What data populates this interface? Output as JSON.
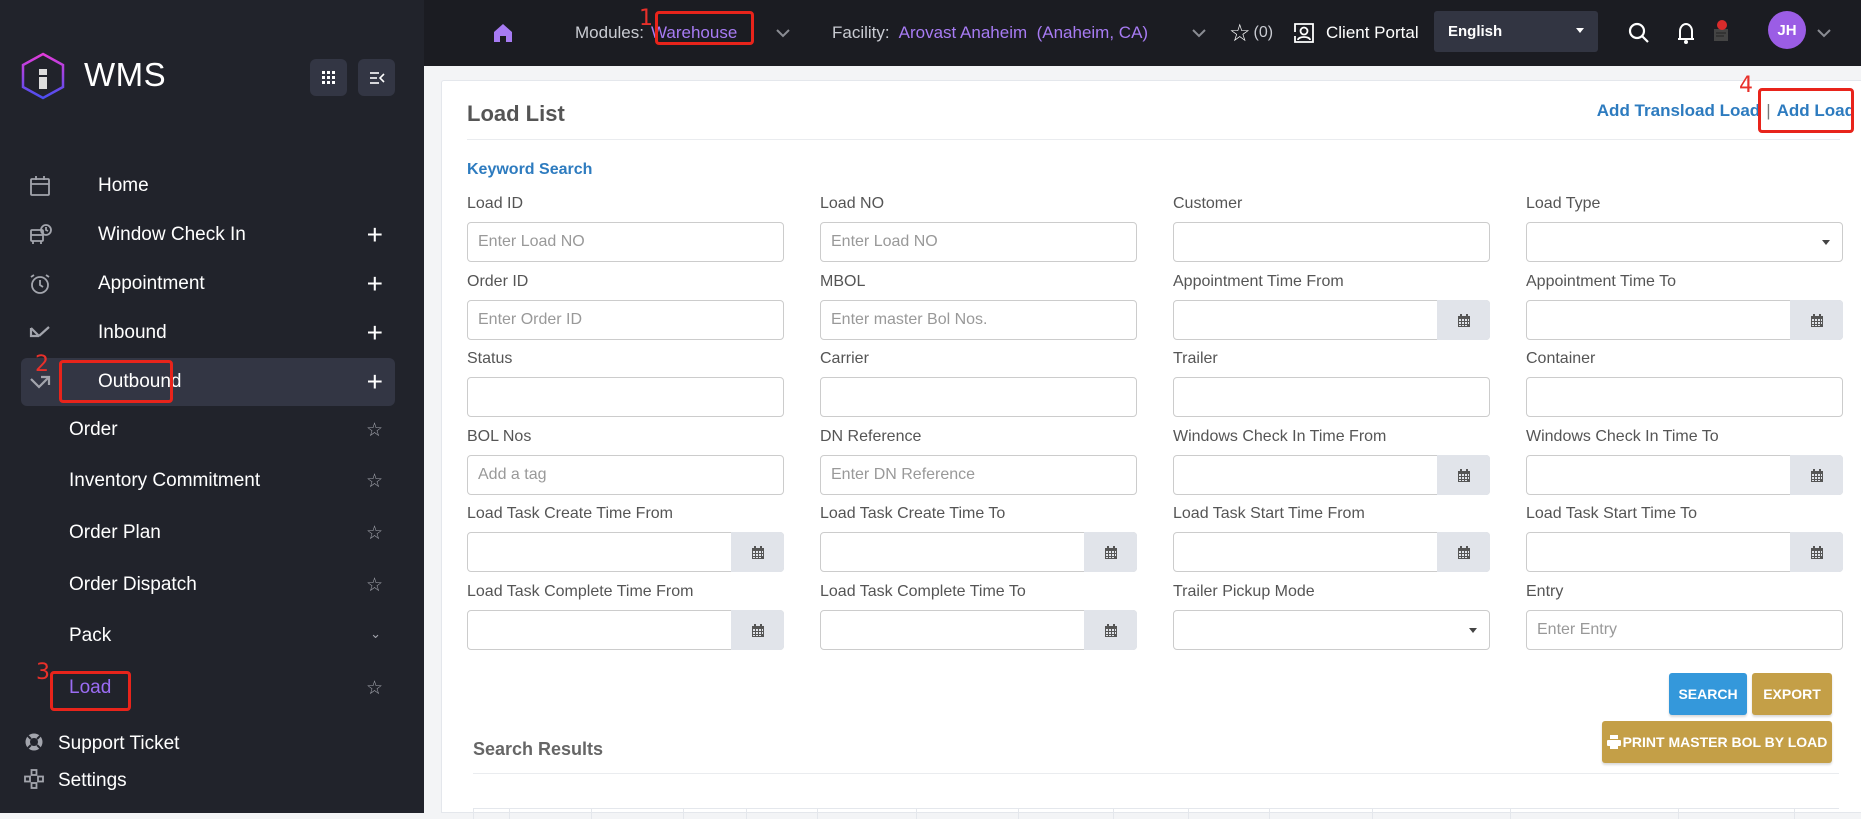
{
  "app": {
    "brand": "WMS"
  },
  "topbar": {
    "modules_label": "Modules:",
    "module_value": "Warehouse",
    "facility_label": "Facility:",
    "facility_value": "Arovast Anaheim  (Anaheim, CA)",
    "favorites_count": "(0)",
    "client_portal": "Client Portal",
    "language": "English",
    "avatar_initials": "JH",
    "accent_color": "#a77bf3"
  },
  "sidebar": {
    "items": [
      {
        "label": "Home",
        "icon": "calendar-icon"
      },
      {
        "label": "Window Check In",
        "icon": "truck-clock-icon"
      },
      {
        "label": "Appointment",
        "icon": "alarm-clock-icon"
      },
      {
        "label": "Inbound",
        "icon": "inbound-arrow-icon"
      },
      {
        "label": "Outbound",
        "icon": "outbound-arrow-icon"
      }
    ],
    "sub_items": [
      {
        "label": "Order"
      },
      {
        "label": "Inventory Commitment"
      },
      {
        "label": "Order Plan"
      },
      {
        "label": "Order Dispatch"
      },
      {
        "label": "Pack"
      },
      {
        "label": "Load"
      }
    ],
    "footer": [
      {
        "label": "Support Ticket",
        "icon": "lifebuoy-icon"
      },
      {
        "label": "Settings",
        "icon": "settings-nodes-icon"
      }
    ]
  },
  "annotations": [
    "1",
    "2",
    "3",
    "4"
  ],
  "page": {
    "title": "Load List",
    "add_transload": "Add Transload Load",
    "separator": "|",
    "add_load": "Add Load",
    "keyword_search": "Keyword Search",
    "fields": [
      {
        "label": "Load ID",
        "placeholder": "Enter Load NO",
        "type": "text"
      },
      {
        "label": "Load NO",
        "placeholder": "Enter Load NO",
        "type": "text"
      },
      {
        "label": "Customer",
        "placeholder": "",
        "type": "text"
      },
      {
        "label": "Load Type",
        "placeholder": "",
        "type": "select"
      },
      {
        "label": "Order ID",
        "placeholder": "Enter Order ID",
        "type": "text"
      },
      {
        "label": "MBOL",
        "placeholder": "Enter master Bol Nos.",
        "type": "text"
      },
      {
        "label": "Appointment Time From",
        "placeholder": "",
        "type": "date"
      },
      {
        "label": "Appointment Time To",
        "placeholder": "",
        "type": "date"
      },
      {
        "label": "Status",
        "placeholder": "",
        "type": "text"
      },
      {
        "label": "Carrier",
        "placeholder": "",
        "type": "text"
      },
      {
        "label": "Trailer",
        "placeholder": "",
        "type": "text"
      },
      {
        "label": "Container",
        "placeholder": "",
        "type": "text"
      },
      {
        "label": "BOL Nos",
        "placeholder": "Add a tag",
        "type": "text"
      },
      {
        "label": "DN Reference",
        "placeholder": "Enter DN Reference",
        "type": "text"
      },
      {
        "label": "Windows Check In Time From",
        "placeholder": "",
        "type": "date"
      },
      {
        "label": "Windows Check In Time To",
        "placeholder": "",
        "type": "date"
      },
      {
        "label": "Load Task Create Time From",
        "placeholder": "",
        "type": "date"
      },
      {
        "label": "Load Task Create Time To",
        "placeholder": "",
        "type": "date"
      },
      {
        "label": "Load Task Start Time From",
        "placeholder": "",
        "type": "date"
      },
      {
        "label": "Load Task Start Time To",
        "placeholder": "",
        "type": "date"
      },
      {
        "label": "Load Task Complete Time From",
        "placeholder": "",
        "type": "date"
      },
      {
        "label": "Load Task Complete Time To",
        "placeholder": "",
        "type": "date"
      },
      {
        "label": "Trailer Pickup Mode",
        "placeholder": "",
        "type": "select"
      },
      {
        "label": "Entry",
        "placeholder": "Enter Entry",
        "type": "text"
      }
    ],
    "buttons": {
      "search": "SEARCH",
      "export": "EXPORT",
      "print_master_bol": "PRINT MASTER BOL BY LOAD"
    },
    "search_results": "Search Results",
    "colors": {
      "link": "#2d7bbf",
      "search_button": "#3498db",
      "gold_button": "#c49f47"
    }
  }
}
